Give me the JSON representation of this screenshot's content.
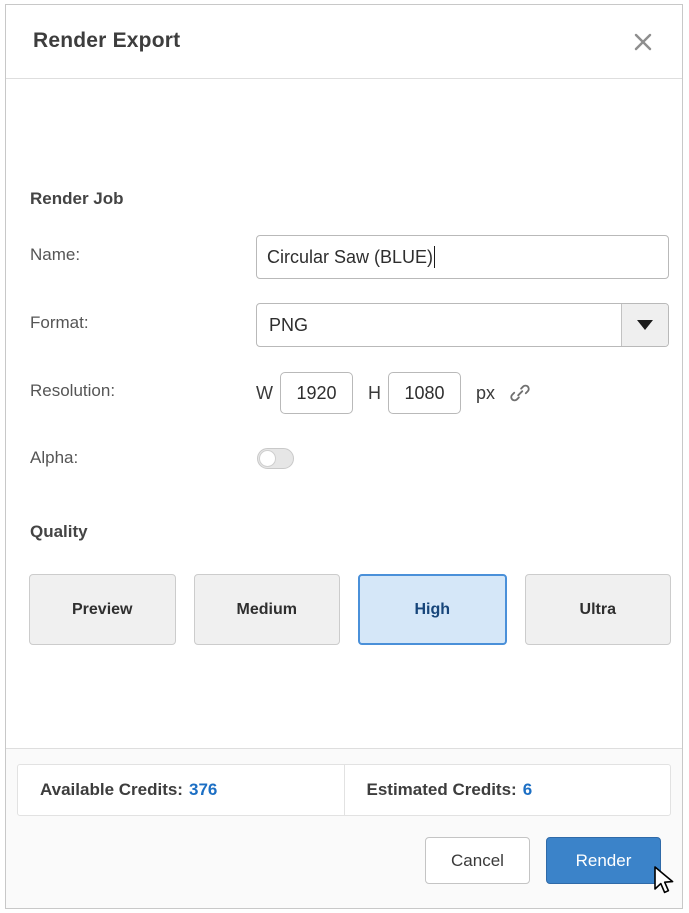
{
  "dialog": {
    "title": "Render Export",
    "close_icon": "close-icon"
  },
  "render_job": {
    "section_title": "Render Job",
    "name": {
      "label": "Name:",
      "value": "Circular Saw (BLUE)"
    },
    "format": {
      "label": "Format:",
      "value": "PNG",
      "arrow_icon": "chevron-down-icon"
    },
    "resolution": {
      "label": "Resolution:",
      "width_axis": "W",
      "width_value": "1920",
      "height_axis": "H",
      "height_value": "1080",
      "unit": "px",
      "link_icon": "link-icon"
    },
    "alpha": {
      "label": "Alpha:",
      "state": "off"
    }
  },
  "quality": {
    "section_title": "Quality",
    "options": [
      {
        "label": "Preview",
        "selected": false
      },
      {
        "label": "Medium",
        "selected": false
      },
      {
        "label": "High",
        "selected": true
      },
      {
        "label": "Ultra",
        "selected": false
      }
    ]
  },
  "credits": {
    "available_label": "Available Credits:",
    "available_value": "376",
    "estimated_label": "Estimated Credits:",
    "estimated_value": "6"
  },
  "actions": {
    "cancel_label": "Cancel",
    "render_label": "Render"
  },
  "colors": {
    "accent_blue": "#3b83c9",
    "link_blue": "#1c6fc4",
    "selected_fill": "#d5e7f8",
    "selected_border": "#4a90d9",
    "selected_text": "#16457a"
  }
}
